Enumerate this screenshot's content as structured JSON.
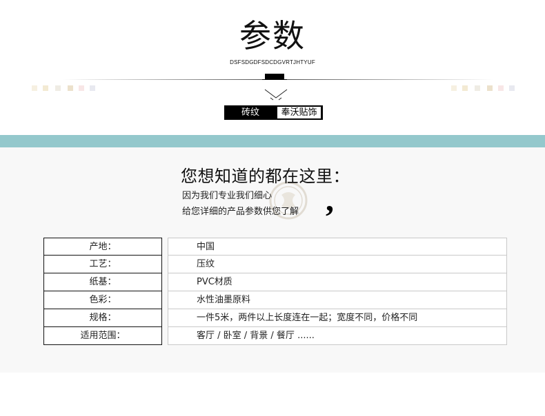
{
  "header": {
    "title": "参数",
    "subtitle": "DSFSDGDFSDCDGVRTJHTYUF",
    "tag_left": "砖纹",
    "tag_right": "奉沃贴饰"
  },
  "colors": {
    "band": "#94c8cc",
    "panel": "#f8f8f8",
    "squares": [
      "#f5efe0",
      "#f3ebd2",
      "#ece8e0",
      "#ece2cf",
      "#f8e6e6",
      "#e8e8f0"
    ]
  },
  "intro": {
    "headline": "您想知道的都在这里：",
    "line1": "因为我们专业我们细心",
    "line2": "给您详细的产品参数供您了解",
    "comma": ","
  },
  "params": [
    {
      "label": "产地：",
      "value": "中国"
    },
    {
      "label": "工艺：",
      "value": "压纹"
    },
    {
      "label": "纸基：",
      "value": "PVC材质"
    },
    {
      "label": "色彩：",
      "value": "水性油墨原料"
    },
    {
      "label": "规格：",
      "value": "一件5米，两件以上长度连在一起；宽度不同，价格不同"
    },
    {
      "label": "适用范围：",
      "value": "客厅 / 卧室 / 背景 / 餐厅 ......"
    }
  ]
}
